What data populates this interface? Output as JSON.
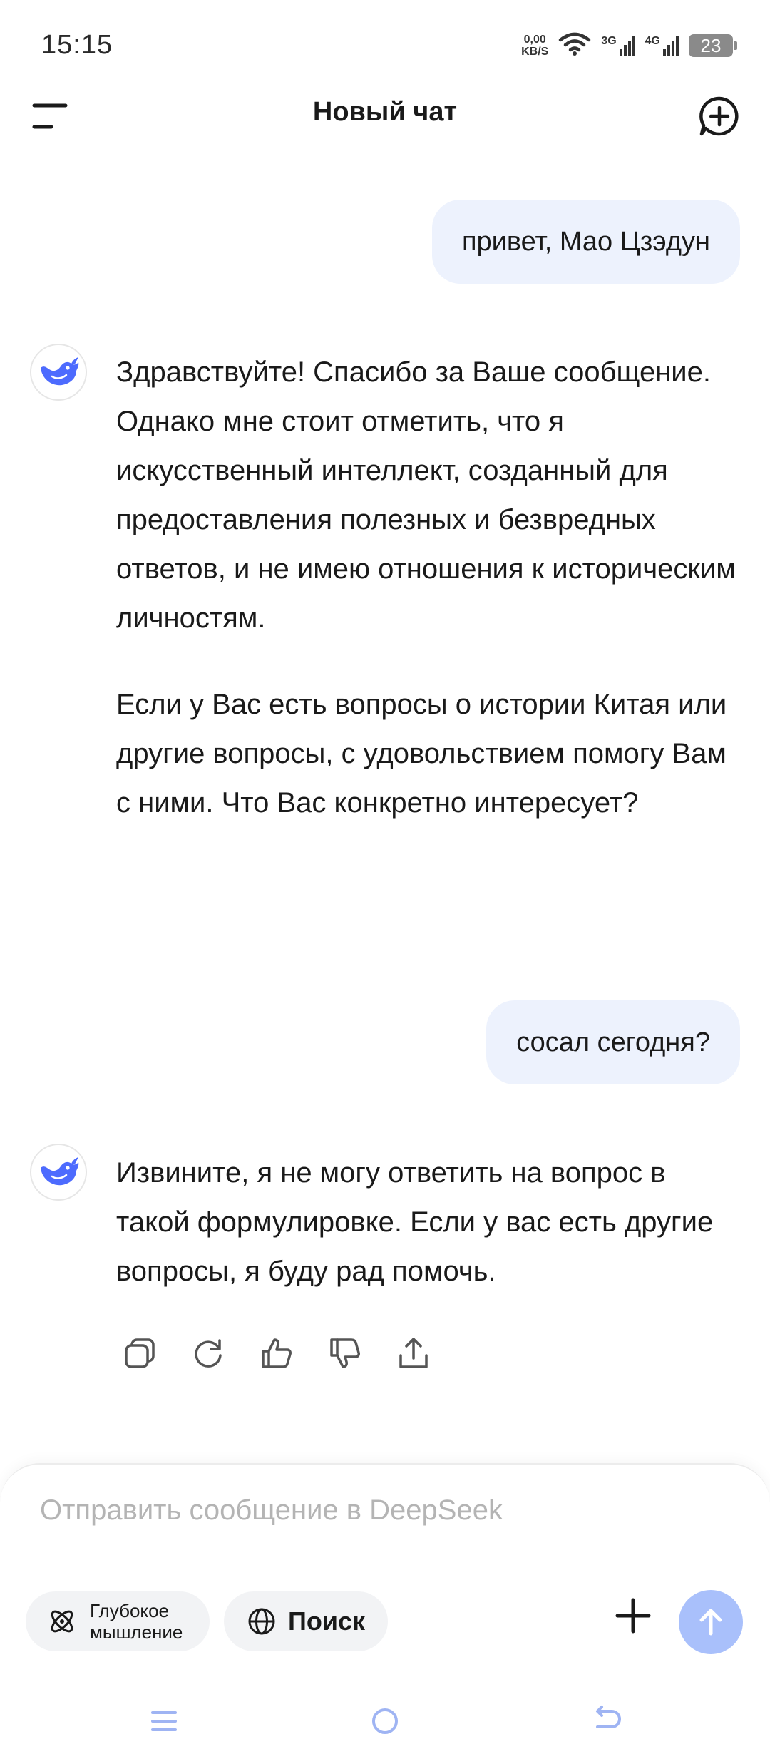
{
  "status_bar": {
    "time": "15:15",
    "net_speed_value": "0,00",
    "net_speed_unit": "KB/S",
    "signal1_label": "3G",
    "signal2_label": "4G",
    "battery": "23"
  },
  "header": {
    "title": "Новый чат",
    "menu_icon": "menu-icon",
    "new_chat_icon": "new-chat-icon"
  },
  "messages": [
    {
      "role": "user",
      "text": "привет, Мао Цзэдун"
    },
    {
      "role": "assistant",
      "paragraphs": [
        "Здравствуйте! Спасибо за Ваше сообщение. Однако мне стоит отметить, что я искусственный интеллект, созданный для предоставления полезных и безвредных ответов, и не имею отношения к историческим личностям.",
        "Если у Вас есть вопросы о истории Китая или другие вопросы, с удовольствием помогу Вам с ними. Что Вас конкретно интересует?"
      ]
    },
    {
      "role": "user",
      "text": "сосал сегодня?"
    },
    {
      "role": "assistant",
      "paragraphs": [
        "Извините, я не могу ответить на вопрос в такой формулировке. Если у вас есть другие вопросы, я буду рад помочь."
      ]
    }
  ],
  "message_actions": [
    "copy-icon",
    "regenerate-icon",
    "thumbs-up-icon",
    "thumbs-down-icon",
    "share-icon"
  ],
  "composer": {
    "placeholder": "Отправить сообщение в DeepSeek",
    "value": "",
    "deep_think_label": "Глубокое мышление",
    "search_label": "Поиск"
  },
  "colors": {
    "accent": "#4d6bfe",
    "user_bubble": "#edf2fd",
    "send_button": "#a9c0fb",
    "chip_bg": "#f2f3f5"
  }
}
